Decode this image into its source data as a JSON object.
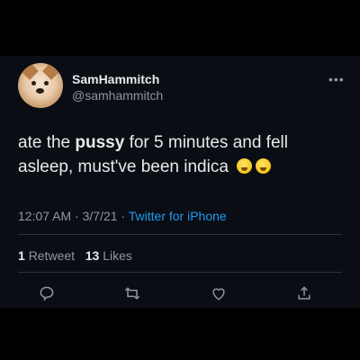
{
  "user": {
    "display_name": "SamHammitch",
    "handle": "@samhammitch",
    "more_label": "•••",
    "avatar_icon": "dog-avatar"
  },
  "tweet": {
    "text_part1": "ate the ",
    "text_bold": "pussy",
    "text_part2": " for 5 minutes and fell asleep, must've been indica",
    "emoji_icon": "zipper-mouth-face-emoji"
  },
  "meta": {
    "time": "12:07 AM",
    "date": "3/7/21",
    "source": "Twitter for iPhone",
    "separator": " · "
  },
  "stats": {
    "retweets_count": "1",
    "retweets_label": "Retweet",
    "likes_count": "13",
    "likes_label": "Likes"
  },
  "actions": [
    "reply-icon",
    "retweet-icon",
    "like-icon",
    "share-icon"
  ],
  "colors": {
    "background": "#0b0d14",
    "text": "#e7e9ea",
    "muted": "#8b98a5",
    "link": "#1d9bf0"
  }
}
